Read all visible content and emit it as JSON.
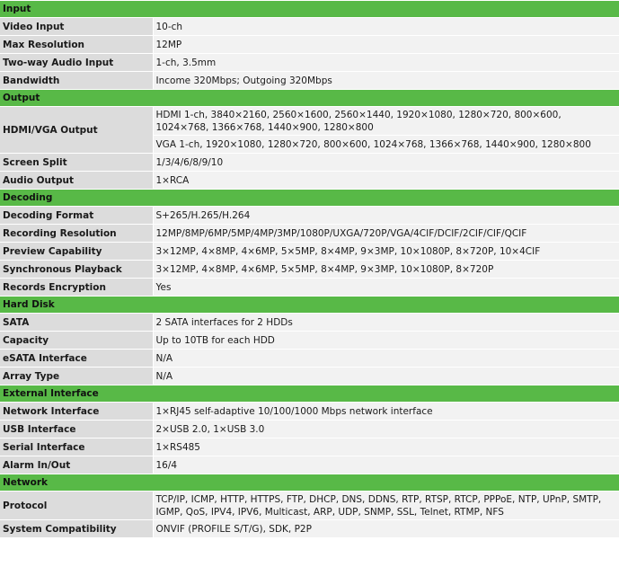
{
  "sections": [
    {
      "title": "Input",
      "rows": [
        {
          "label": "Video Input",
          "value": "10-ch"
        },
        {
          "label": "Max Resolution",
          "value": "12MP"
        },
        {
          "label": "Two-way Audio Input",
          "value": "1-ch, 3.5mm"
        },
        {
          "label": "Bandwidth",
          "value": "Income 320Mbps; Outgoing 320Mbps"
        }
      ]
    },
    {
      "title": "Output",
      "hdmi_label": "HDMI/VGA Output",
      "hdmi_value": "HDMI 1-ch, 3840×2160, 2560×1600, 2560×1440, 1920×1080, 1280×720, 800×600, 1024×768, 1366×768, 1440×900, 1280×800",
      "vga_value": "VGA 1-ch, 1920×1080, 1280×720, 800×600, 1024×768, 1366×768, 1440×900, 1280×800",
      "rows": [
        {
          "label": "Screen Split",
          "value": "1/3/4/6/8/9/10"
        },
        {
          "label": "Audio Output",
          "value": "1×RCA"
        }
      ]
    },
    {
      "title": "Decoding",
      "rows": [
        {
          "label": "Decoding Format",
          "value": "S+265/H.265/H.264"
        },
        {
          "label": "Recording Resolution",
          "value": "12MP/8MP/6MP/5MP/4MP/3MP/1080P/UXGA/720P/VGA/4CIF/DCIF/2CIF/CIF/QCIF"
        },
        {
          "label": "Preview Capability",
          "value": "3×12MP, 4×8MP, 4×6MP, 5×5MP, 8×4MP, 9×3MP, 10×1080P, 8×720P, 10×4CIF"
        },
        {
          "label": "Synchronous Playback",
          "value": "3×12MP, 4×8MP, 4×6MP, 5×5MP, 8×4MP, 9×3MP, 10×1080P, 8×720P"
        },
        {
          "label": "Records Encryption",
          "value": "Yes"
        }
      ]
    },
    {
      "title": "Hard Disk",
      "rows": [
        {
          "label": "SATA",
          "value": "2 SATA interfaces for 2 HDDs"
        },
        {
          "label": "Capacity",
          "value": "Up to 10TB for each HDD"
        },
        {
          "label": "eSATA Interface",
          "value": "N/A"
        },
        {
          "label": "Array Type",
          "value": "N/A"
        }
      ]
    },
    {
      "title": "External Interface",
      "rows": [
        {
          "label": "Network Interface",
          "value": "1×RJ45 self-adaptive 10/100/1000 Mbps network interface"
        },
        {
          "label": "USB Interface",
          "value": "2×USB 2.0, 1×USB 3.0"
        },
        {
          "label": "Serial Interface",
          "value": "1×RS485"
        },
        {
          "label": "Alarm In/Out",
          "value": "16/4"
        }
      ]
    },
    {
      "title": "Network",
      "rows": [
        {
          "label": "Protocol",
          "value": "TCP/IP, ICMP, HTTP, HTTPS, FTP, DHCP, DNS, DDNS, RTP, RTSP, RTCP, PPPoE, NTP, UPnP, SMTP, IGMP, QoS, IPV4, IPV6, Multicast, ARP, UDP, SNMP, SSL, Telnet, RTMP, NFS"
        },
        {
          "label": "System Compatibility",
          "value": "ONVIF (PROFILE S/T/G), SDK, P2P"
        }
      ]
    }
  ]
}
